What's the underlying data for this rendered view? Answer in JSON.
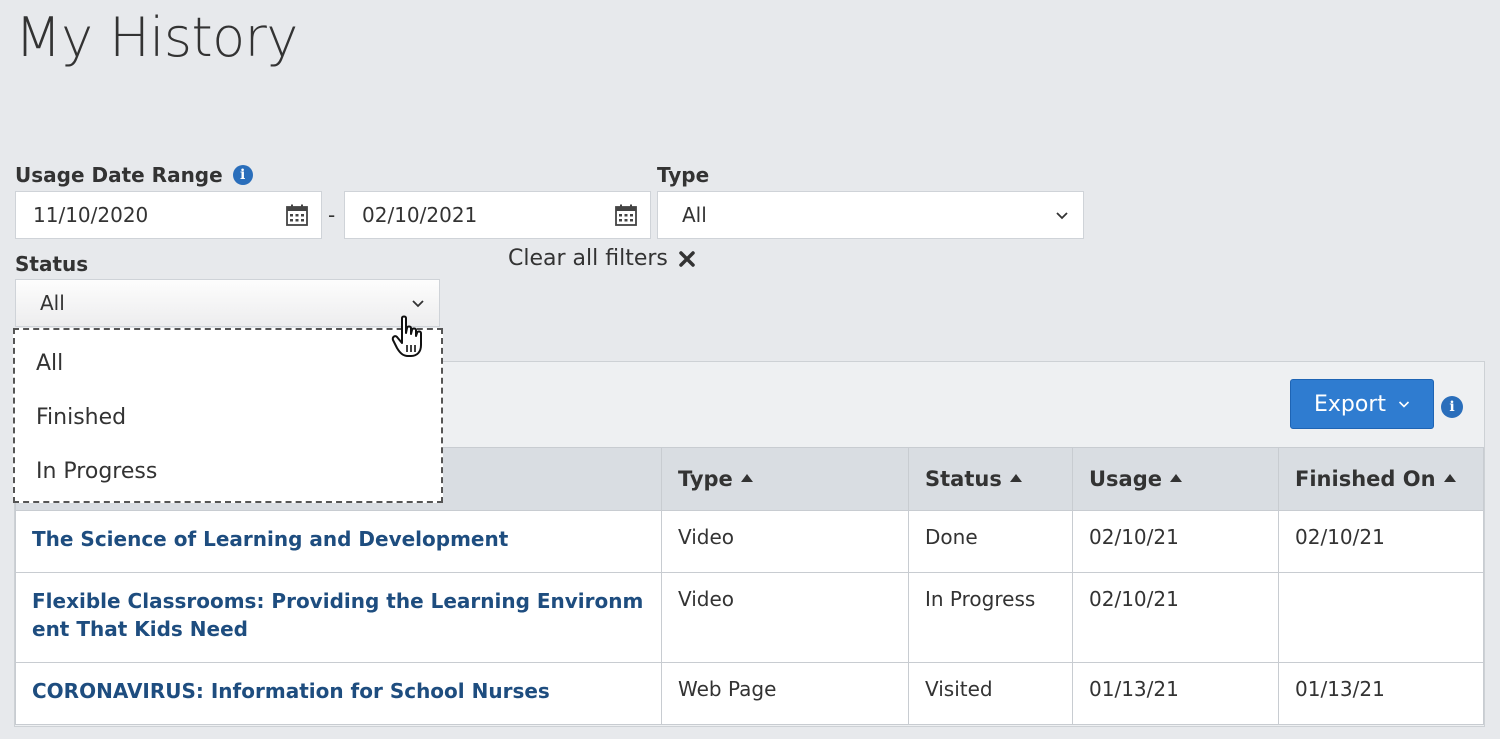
{
  "page": {
    "title": "My History"
  },
  "filters": {
    "date_range_label": "Usage Date Range",
    "date_from": "11/10/2020",
    "date_separator": "-",
    "date_to": "02/10/2021",
    "type_label": "Type",
    "type_value": "All",
    "status_label": "Status",
    "status_value": "All",
    "clear_label": "Clear all filters"
  },
  "status_dropdown": {
    "options": [
      "All",
      "Finished",
      "In Progress"
    ]
  },
  "toolbar": {
    "export_label": "Export"
  },
  "table": {
    "columns": [
      "Type",
      "Status",
      "Usage",
      "Finished On"
    ],
    "rows": [
      {
        "title": "The Science of Learning and Development",
        "type": "Video",
        "status": "Done",
        "usage": "02/10/21",
        "finished_on": "02/10/21"
      },
      {
        "title": "Flexible Classrooms: Providing the Learning Environment That Kids Need",
        "type": "Video",
        "status": "In Progress",
        "usage": "02/10/21",
        "finished_on": ""
      },
      {
        "title": "CORONAVIRUS: Information for School Nurses",
        "type": "Web Page",
        "status": "Visited",
        "usage": "01/13/21",
        "finished_on": "01/13/21"
      }
    ]
  },
  "colors": {
    "accent": "#2f7cd0",
    "link": "#1e4d7f",
    "background": "#e7e9ec"
  }
}
